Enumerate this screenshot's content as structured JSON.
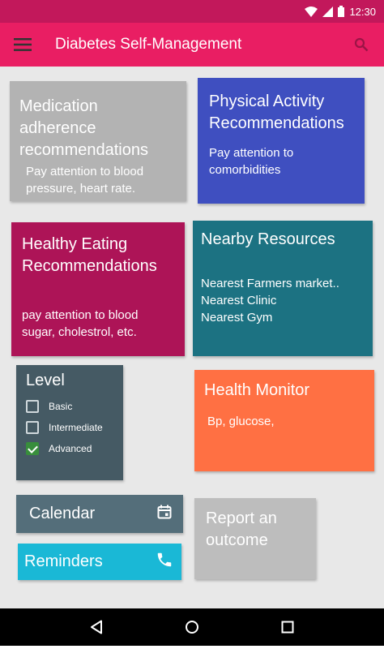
{
  "status_bar": {
    "time": "12:30"
  },
  "app_bar": {
    "title": "Diabetes Self-Management"
  },
  "tiles": {
    "medication": {
      "title": "Medication adherence recommendations",
      "body": "Pay attention to blood pressure, heart rate."
    },
    "physical": {
      "title": "Physical Activity Recommendations",
      "body": "Pay attention to comorbidities"
    },
    "eating": {
      "title": "Healthy Eating Recommendations",
      "body": "pay attention to blood sugar, cholestrol, etc."
    },
    "nearby": {
      "title": "Nearby Resources",
      "lines": [
        "Nearest Farmers market..",
        "Nearest Clinic",
        "Nearest Gym"
      ]
    },
    "level": {
      "title": "Level",
      "options": [
        {
          "label": "Basic",
          "checked": false
        },
        {
          "label": "Intermediate",
          "checked": false
        },
        {
          "label": "Advanced",
          "checked": true
        }
      ]
    },
    "health": {
      "title": "Health Monitor",
      "body": "Bp, glucose,"
    },
    "calendar": {
      "label": "Calendar"
    },
    "reminders": {
      "label": "Reminders"
    },
    "report": {
      "label": "Report an outcome"
    }
  },
  "icons": {
    "menu": "menu-icon",
    "search": "search-icon",
    "wifi": "wifi-icon",
    "signal": "signal-icon",
    "battery": "battery-icon",
    "calendar": "calendar-icon",
    "phone": "phone-icon",
    "back": "back-icon",
    "home": "home-icon",
    "recents": "recents-icon"
  },
  "colors": {
    "status_bar": "#c2185b",
    "app_bar": "#e91e63",
    "medication": "#b3b3b3",
    "physical": "#3f4fc0",
    "eating": "#ad1457",
    "nearby": "#1c7282",
    "level": "#455a64",
    "health": "#ff7043",
    "calendar": "#546e7a",
    "reminders": "#1ab8d6",
    "report": "#bdbdbd",
    "check": "#388e3c"
  }
}
